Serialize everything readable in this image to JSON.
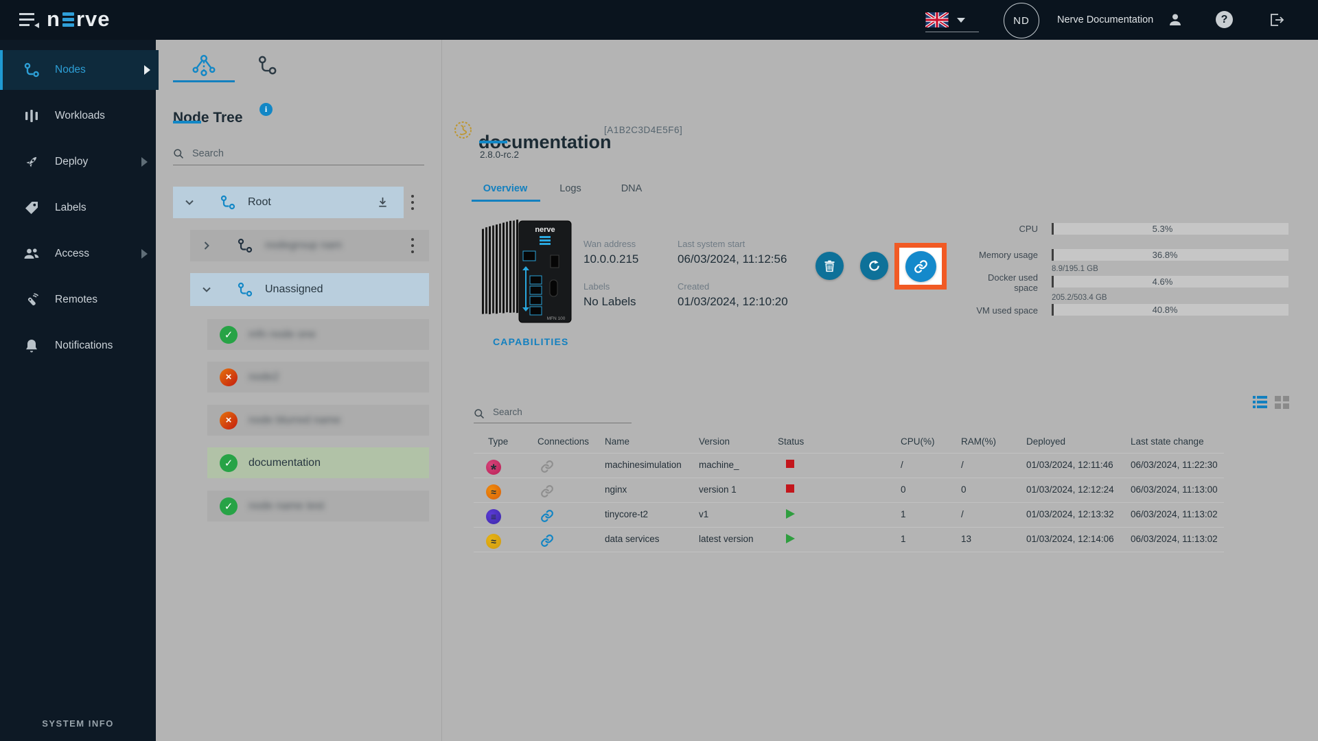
{
  "topbar": {
    "logo_text": "nerve",
    "language_flag": "uk-flag",
    "user_initials": "ND",
    "user_name": "Nerve Documentation",
    "help_glyph": "?"
  },
  "sidebar": {
    "items": [
      {
        "label": "Nodes"
      },
      {
        "label": "Workloads"
      },
      {
        "label": "Deploy"
      },
      {
        "label": "Labels"
      },
      {
        "label": "Access"
      },
      {
        "label": "Remotes"
      },
      {
        "label": "Notifications"
      }
    ],
    "footer_label": "SYSTEM INFO"
  },
  "tree_panel": {
    "title": "Node Tree",
    "search_placeholder": "Search",
    "groups": {
      "root": {
        "label": "Root",
        "blur": "clear"
      },
      "sub": {
        "label": "nodegroup nam",
        "blur": "blurred"
      },
      "unassigned": {
        "label": "Unassigned",
        "blur": "clear"
      }
    },
    "nodes": [
      {
        "label": "mfn node one",
        "status": "online",
        "blur": "blurred"
      },
      {
        "label": "node2",
        "status": "offline",
        "blur": "blurred"
      },
      {
        "label": "node blurred name",
        "status": "offline",
        "blur": "blurred"
      },
      {
        "label": "documentation",
        "status": "online",
        "blur": "clear"
      },
      {
        "label": "node name test",
        "status": "online",
        "blur": "blurred"
      }
    ]
  },
  "node_detail": {
    "name": "documentation",
    "node_id": "[A1B2C3D4E5F6]",
    "version": "2.8.0-rc.2",
    "tabs": [
      {
        "label": "Overview"
      },
      {
        "label": "Logs"
      },
      {
        "label": "DNA"
      }
    ],
    "fields": [
      {
        "label": "Wan address",
        "value": "10.0.0.215"
      },
      {
        "label": "Last system start",
        "value": "06/03/2024, 11:12:56"
      },
      {
        "label": "Labels",
        "value": "No Labels"
      },
      {
        "label": "Created",
        "value": "01/03/2024, 12:10:20"
      }
    ],
    "capabilities_label": "CAPABILITIES",
    "highlight_color": "#f15a24",
    "stats": [
      {
        "label": "CPU",
        "sub": "",
        "percent": 5.3,
        "text": "5.3%"
      },
      {
        "label": "Memory usage",
        "sub": "",
        "percent": 36.8,
        "text": "36.8%"
      },
      {
        "label": "Docker used space",
        "sub": "8.9/195.1 GB",
        "percent": 4.6,
        "text": "4.6%"
      },
      {
        "label": "VM used space",
        "sub": "205.2/503.4 GB",
        "percent": 40.8,
        "text": "40.8%"
      }
    ]
  },
  "workloads": {
    "search_placeholder": "Search",
    "columns": [
      "Type",
      "Connections",
      "Name",
      "Version",
      "Status",
      "CPU(%)",
      "RAM(%)",
      "Deployed",
      "Last state change"
    ],
    "rows": [
      {
        "type": "codesys",
        "link": "unlinked",
        "name": "machinesimulation",
        "version": "machine_",
        "status": "stopped",
        "cpu": "/",
        "ram": "/",
        "deployed": "01/03/2024, 12:11:46",
        "last_change": "06/03/2024, 11:22:30"
      },
      {
        "type": "docker",
        "link": "unlinked",
        "name": "nginx",
        "version": "version 1",
        "status": "stopped",
        "cpu": "0",
        "ram": "0",
        "deployed": "01/03/2024, 12:12:24",
        "last_change": "06/03/2024, 11:13:00"
      },
      {
        "type": "vm",
        "link": "linked",
        "name": "tinycore-t2",
        "version": "v1",
        "status": "started",
        "cpu": "1",
        "ram": "/",
        "deployed": "01/03/2024, 12:13:32",
        "last_change": "06/03/2024, 11:13:02"
      },
      {
        "type": "compose",
        "link": "linked",
        "name": "data services",
        "version": "latest version",
        "status": "started",
        "cpu": "1",
        "ram": "13",
        "deployed": "01/03/2024, 12:14:06",
        "last_change": "06/03/2024, 11:13:02"
      }
    ]
  }
}
